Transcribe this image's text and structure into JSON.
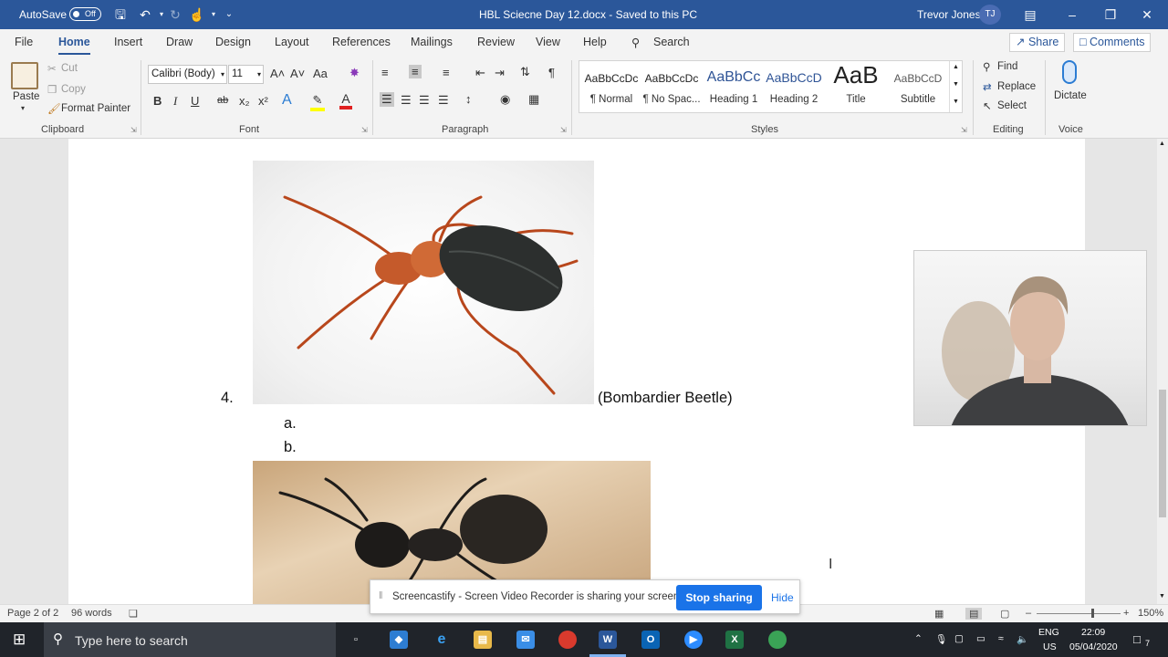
{
  "titlebar": {
    "autosave_label": "AutoSave",
    "autosave_state": "Off",
    "doc_title": "HBL Sciecne Day 12.docx  -  Saved to this PC",
    "user_name": "Trevor Jones",
    "user_initials": "TJ",
    "accent": "#2b579a"
  },
  "tabs": [
    "File",
    "Home",
    "Insert",
    "Draw",
    "Design",
    "Layout",
    "References",
    "Mailings",
    "Review",
    "View",
    "Help"
  ],
  "search_label": "Search",
  "share_label": "Share",
  "comments_label": "Comments",
  "clipboard": {
    "paste": "Paste",
    "cut": "Cut",
    "copy": "Copy",
    "format_painter": "Format Painter",
    "group": "Clipboard"
  },
  "font": {
    "family": "Calibri (Body)",
    "size": "11",
    "group": "Font",
    "bold": "B",
    "italic": "I",
    "underline": "U",
    "strike": "ab",
    "sub": "x₂",
    "sup": "x²",
    "case": "Aa",
    "grow": "A˄",
    "shrink": "A˅"
  },
  "paragraph": {
    "group": "Paragraph"
  },
  "styles": {
    "group": "Styles",
    "items": [
      {
        "preview": "AaBbCcDc",
        "name": "¶ Normal"
      },
      {
        "preview": "AaBbCcDc",
        "name": "¶ No Spac..."
      },
      {
        "preview": "AaBbCc",
        "name": "Heading 1"
      },
      {
        "preview": "AaBbCcD",
        "name": "Heading 2"
      },
      {
        "preview": "AaB",
        "name": "Title"
      },
      {
        "preview": "AaBbCcD",
        "name": "Subtitle"
      }
    ]
  },
  "editing": {
    "find": "Find",
    "replace": "Replace",
    "select": "Select",
    "group": "Editing"
  },
  "voice": {
    "dictate": "Dictate",
    "group": "Voice"
  },
  "document": {
    "item_number": "4.",
    "caption": "(Bombardier Beetle)",
    "sub_a": "a.",
    "sub_b": "b."
  },
  "statusbar": {
    "page": "Page 2 of 2",
    "words": "96 words",
    "zoom": "150%",
    "zoom_level": 0.65
  },
  "banner": {
    "message": "Screencastify - Screen Video Recorder is sharing your screen.",
    "stop": "Stop sharing",
    "hide": "Hide"
  },
  "taskbar": {
    "search_placeholder": "Type here to search",
    "lang_top": "ENG",
    "lang_bottom": "US",
    "time": "22:09",
    "date": "05/04/2020",
    "notifications": "7"
  }
}
